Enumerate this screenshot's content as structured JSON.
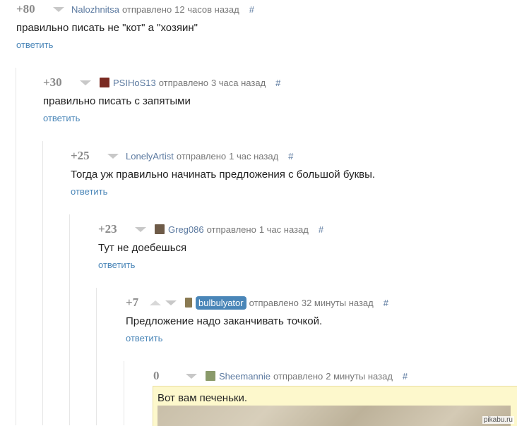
{
  "sent_label": "отправлено",
  "hash_label": "#",
  "reply_label": "ответить",
  "colors": {
    "username": "#5c7aa0",
    "reply_link": "#4a86b8",
    "badge_bg": "#4a86b8",
    "highlight_bg": "#fdf8cc"
  },
  "comments": [
    {
      "rating": "+80",
      "author": "Nalozhnitsa",
      "time": "12 часов назад",
      "text": "правильно писать не \"кот\" а \"хозяин\""
    },
    {
      "rating": "+30",
      "author": "PSIHoS13",
      "time": "3 часа назад",
      "text": "правильно писать с запятыми"
    },
    {
      "rating": "+25",
      "author": "LonelyArtist",
      "time": "1 час назад",
      "text": "Тогда уж правильно начинать предложения с большой буквы."
    },
    {
      "rating": "+23",
      "author": "Greg086",
      "time": "1 час назад",
      "text": "Тут не доебешься"
    },
    {
      "rating": "+7",
      "author": "bulbulyator",
      "time": "32 минуты назад",
      "text": "Предложение надо заканчивать точкой."
    },
    {
      "rating": "0",
      "author": "Sheemannie",
      "time": "2 минуты назад",
      "text": "Вот вам печеньки."
    }
  ],
  "watermark": "pikabu.ru"
}
